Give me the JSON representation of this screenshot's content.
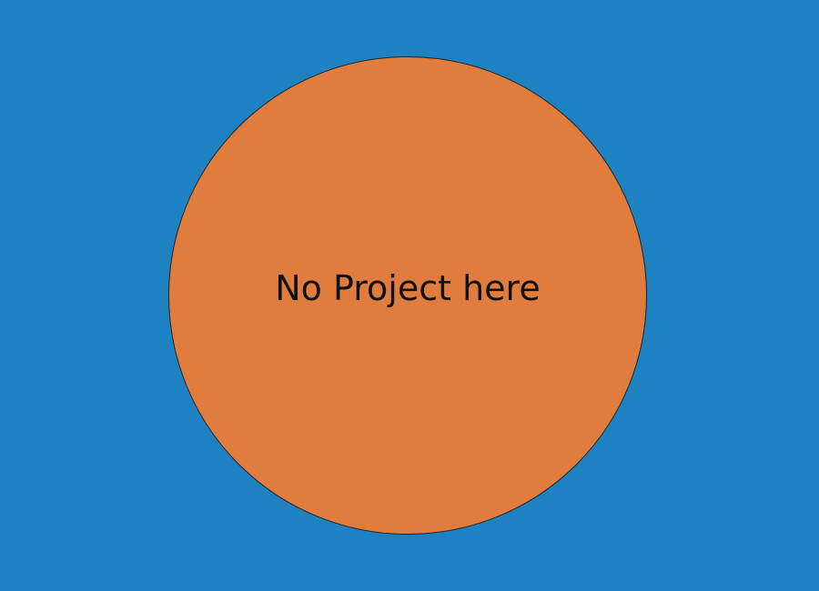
{
  "colors": {
    "background": "#1e82c2",
    "circle_fill": "#e17c3f",
    "text": "#111111"
  },
  "placeholder": {
    "message": "No Project here"
  }
}
